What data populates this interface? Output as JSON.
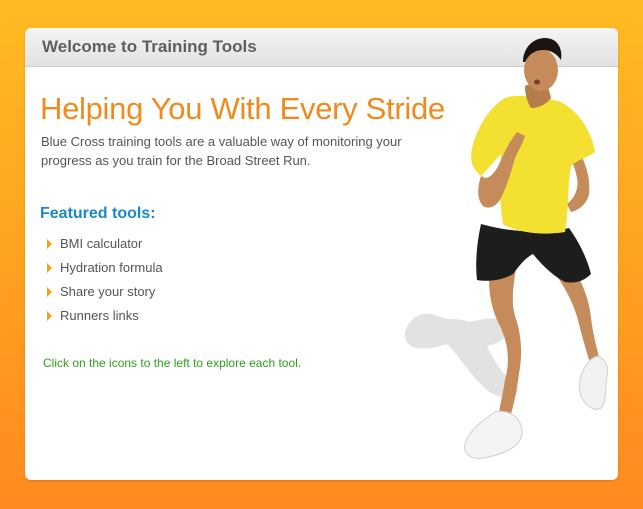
{
  "header": {
    "title": "Welcome to Training Tools"
  },
  "main": {
    "headline": "Helping You With Every Stride",
    "intro": "Blue Cross training tools are a valuable way of monitoring your progress as you train for the Broad Street Run.",
    "featured_heading": "Featured tools:",
    "tools": [
      {
        "label": "BMI calculator"
      },
      {
        "label": "Hydration formula"
      },
      {
        "label": "Share your story"
      },
      {
        "label": "Runners links"
      }
    ],
    "footer_text": "Click on the icons to the left to explore each tool."
  },
  "colors": {
    "headline": "#f08a1d",
    "featured_heading": "#1a8ac7",
    "footer_text": "#2f9e1a",
    "arrow": "#f0a21e",
    "shirt": "#f3e030",
    "shorts": "#1d1d1d",
    "skin": "#c68b5a"
  },
  "image": {
    "subject": "runner-photo"
  }
}
